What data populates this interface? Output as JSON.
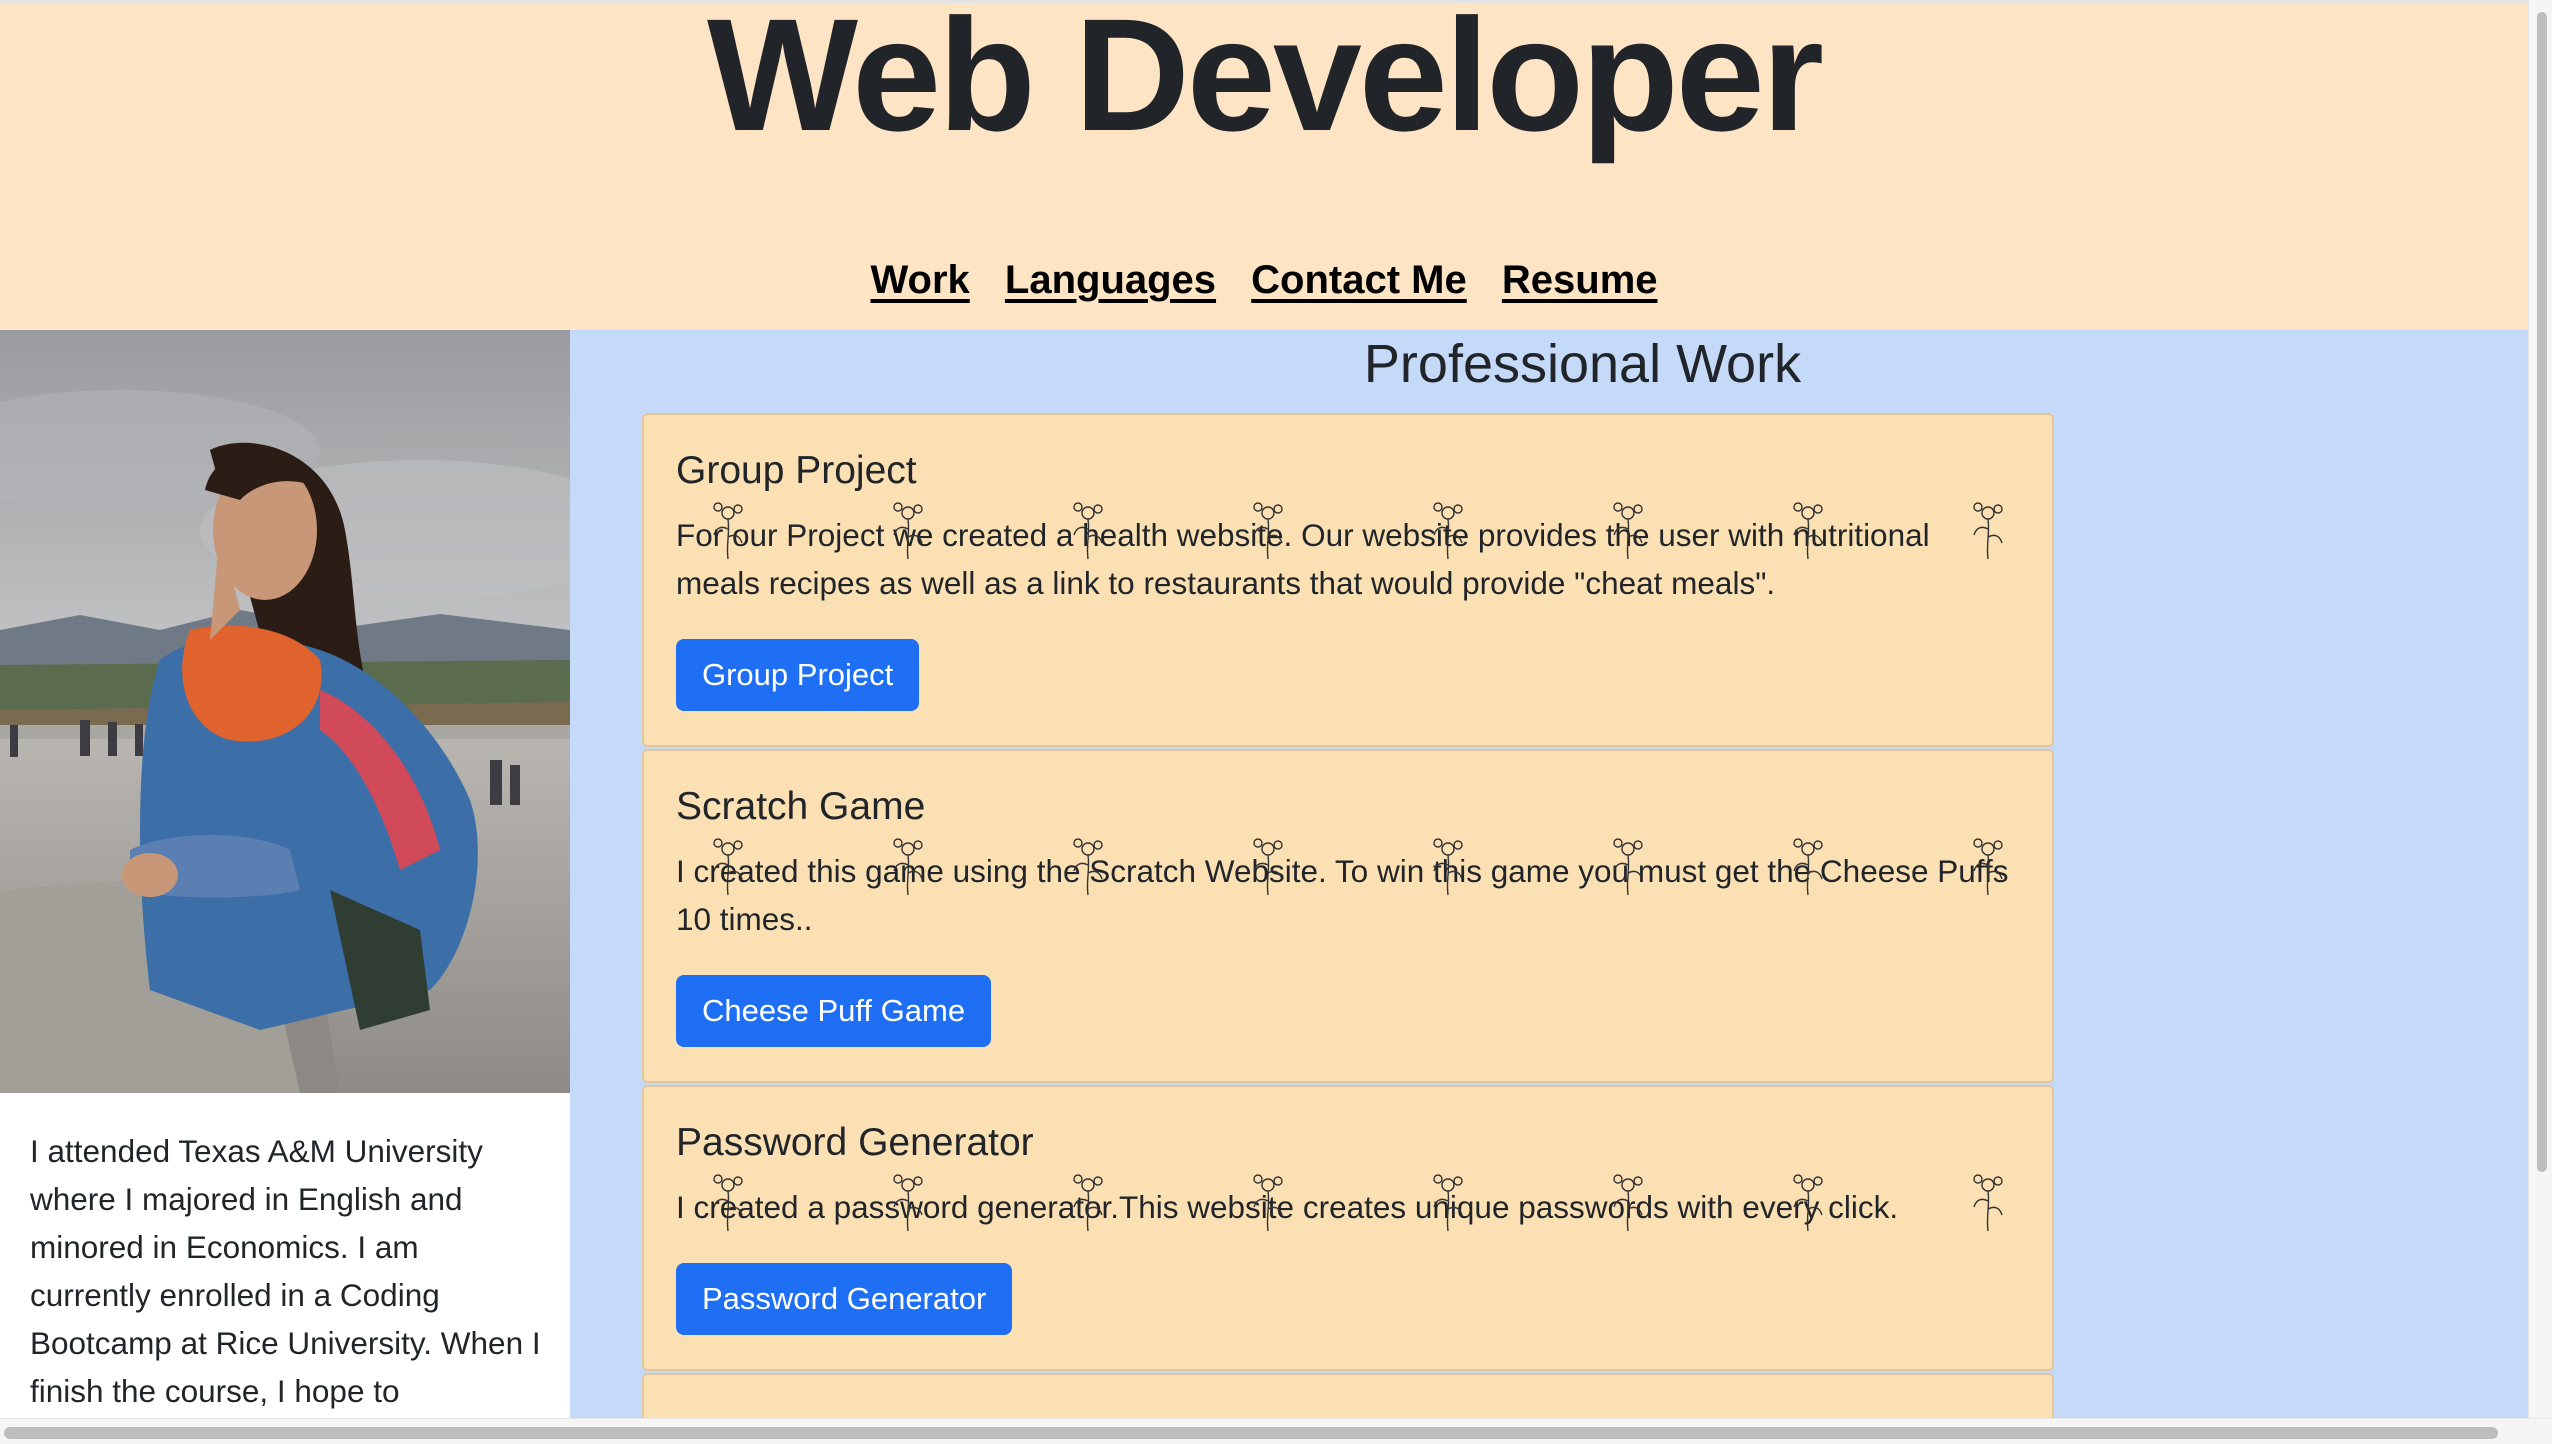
{
  "header": {
    "title": "Web Developer",
    "nav": [
      "Work",
      "Languages",
      "Contact Me",
      "Resume"
    ]
  },
  "sidebar": {
    "photo_alt": "profile-photo",
    "bio": "I attended Texas A&M University where I majored in English and minored in Economics. I am currently enrolled in a Coding Bootcamp at Rice University. When I finish the course, I hope to"
  },
  "main": {
    "section_title": "Professional Work",
    "cards": [
      {
        "title": "Group Project",
        "text": "For our Project we created a health website. Our website provides the user with nutritional meals recipes as well as a link to restaurants that would provide \"cheat meals\".",
        "button": "Group Project"
      },
      {
        "title": "Scratch Game",
        "text": "I created this game using the Scratch Website. To win this game you must get the Cheese Puffs 10 times..",
        "button": "Cheese Puff Game"
      },
      {
        "title": "Password Generator",
        "text": "I created a password generator.This website creates unique passwords with every click.",
        "button": "Password Generator"
      }
    ]
  },
  "colors": {
    "header_bg": "#fde4c4",
    "main_bg": "#c5daf9",
    "card_bg": "#fbe0b3",
    "button_bg": "#1f6ff5"
  }
}
